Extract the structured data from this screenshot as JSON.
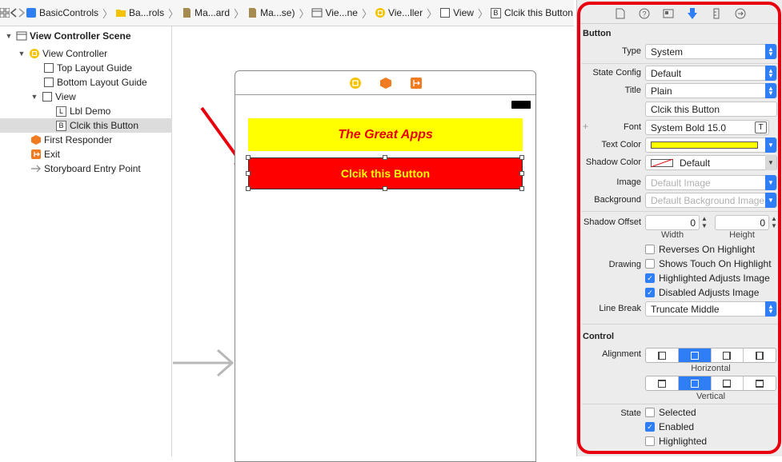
{
  "jumpbar": {
    "crumbs": [
      "BasicControls",
      "Ba...rols",
      "Ma...ard",
      "Ma...se)",
      "Vie...ne",
      "Vie...ller",
      "View",
      "Clcik this Button"
    ]
  },
  "outline": {
    "scene": "View Controller Scene",
    "view_controller": "View Controller",
    "top_guide": "Top Layout Guide",
    "bottom_guide": "Bottom Layout Guide",
    "view": "View",
    "lbl_demo": "Lbl Demo",
    "button": "Clcik this Button",
    "first_responder": "First Responder",
    "exit": "Exit",
    "entry_point": "Storyboard Entry Point",
    "letter_l": "L",
    "letter_b": "B"
  },
  "canvas": {
    "label_text": "The Great Apps",
    "button_text": "Clcik this Button"
  },
  "inspector": {
    "button_section": "Button",
    "type_label": "Type",
    "type_value": "System",
    "state_config_label": "State Config",
    "state_config_value": "Default",
    "title_label": "Title",
    "title_value": "Plain",
    "title_text": "Clcik this Button",
    "font_label": "Font",
    "font_value": "System Bold 15.0",
    "text_color_label": "Text Color",
    "shadow_color_label": "Shadow Color",
    "shadow_color_value": "Default",
    "image_label": "Image",
    "image_placeholder": "Default Image",
    "background_label": "Background",
    "background_placeholder": "Default Background Image",
    "shadow_offset_label": "Shadow Offset",
    "shadow_w": "0",
    "shadow_h": "0",
    "width_label": "Width",
    "height_label": "Height",
    "drawing_label": "Drawing",
    "reverses": "Reverses On Highlight",
    "shows_touch": "Shows Touch On Highlight",
    "highlighted_adjusts": "Highlighted Adjusts Image",
    "disabled_adjusts": "Disabled Adjusts Image",
    "line_break_label": "Line Break",
    "line_break_value": "Truncate Middle",
    "control_section": "Control",
    "alignment_label": "Alignment",
    "horizontal_label": "Horizontal",
    "vertical_label": "Vertical",
    "state_label": "State",
    "selected": "Selected",
    "enabled": "Enabled",
    "highlighted": "Highlighted",
    "font_plus": "+",
    "font_t": "T"
  },
  "colors": {
    "label_bg": "#ffff00",
    "label_text": "#e60000",
    "button_bg": "#ff0000",
    "button_text": "#ffff00",
    "accent": "#2f7ef5",
    "annotation": "#e8000f"
  }
}
